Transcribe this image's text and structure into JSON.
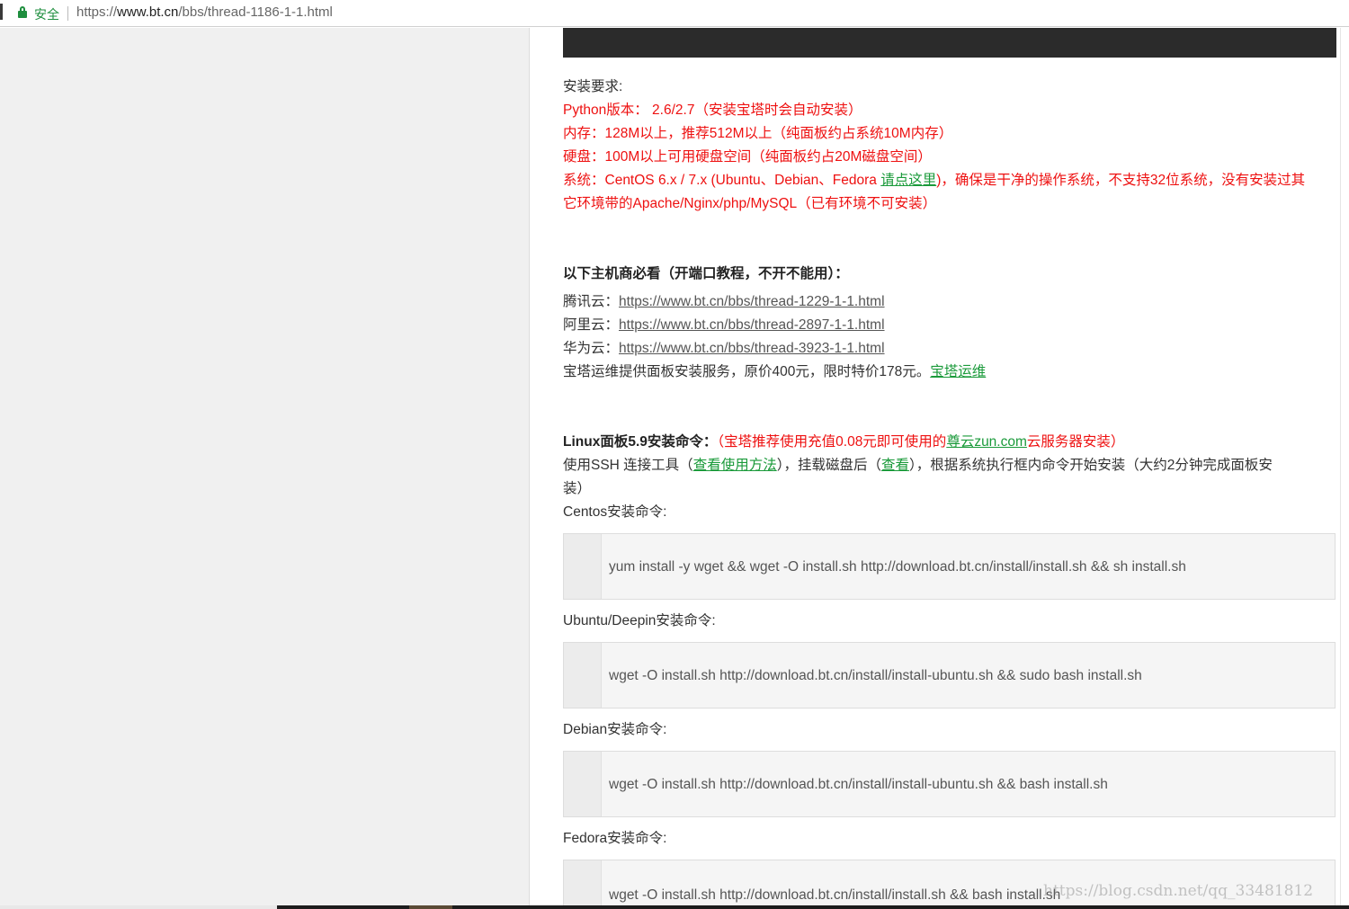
{
  "browser": {
    "secure_label": "安全",
    "url_scheme": "https://",
    "url_host": "www.bt.cn",
    "url_path": "/bbs/thread-1186-1-1.html"
  },
  "requirements": {
    "heading": "安装要求:",
    "python": "Python版本： 2.6/2.7（安装宝塔时会自动安装）",
    "memory": "内存：128M以上，推荐512M以上（纯面板约占系统10M内存）",
    "disk": "硬盘：100M以上可用硬盘空间（纯面板约占20M磁盘空间）",
    "system_prefix": "系统：CentOS 6.x / 7.x (Ubuntu、Debian、Fedora ",
    "system_link": "请点这里",
    "system_suffix": ")，确保是干净的操作系统，不支持32位系统，没有安装过其",
    "system_line2": "它环境带的Apache/Nginx/php/MySQL（已有环境不可安装）"
  },
  "hosts": {
    "heading": "以下主机商必看（开端口教程，不开不能用）：",
    "items": [
      {
        "label": "腾讯云：",
        "url": "https://www.bt.cn/bbs/thread-1229-1-1.html"
      },
      {
        "label": "阿里云：",
        "url": "https://www.bt.cn/bbs/thread-2897-1-1.html"
      },
      {
        "label": "华为云：",
        "url": "https://www.bt.cn/bbs/thread-3923-1-1.html"
      }
    ],
    "service_text": "宝塔运维提供面板安装服务，原价400元，限时特价178元。",
    "service_link": "宝塔运维"
  },
  "install": {
    "heading": "Linux面板5.9安装命令：",
    "promo_prefix": "（宝塔推荐使用充值0.08元即可使用的",
    "promo_link": "尊云zun.com",
    "promo_suffix": "云服务器安装）",
    "ssh_a": "使用SSH 连接工具（",
    "ssh_link1": "查看使用方法",
    "ssh_b": "），挂载磁盘后（",
    "ssh_link2": "查看",
    "ssh_c": "），根据系统执行框内命令开始安装（大约2分钟完成面板安",
    "ssh_line2": "装）",
    "centos_label": "Centos安装命令:",
    "centos_cmd": "yum install -y wget && wget -O install.sh http://download.bt.cn/install/install.sh && sh install.sh",
    "ubuntu_label": "Ubuntu/Deepin安装命令:",
    "ubuntu_cmd": "wget -O install.sh http://download.bt.cn/install/install-ubuntu.sh && sudo bash install.sh",
    "debian_label": "Debian安装命令:",
    "debian_cmd": "wget -O install.sh http://download.bt.cn/install/install-ubuntu.sh && bash install.sh",
    "fedora_label": "Fedora安装命令:",
    "fedora_cmd": "wget -O install.sh http://download.bt.cn/install/install.sh && bash install.sh"
  },
  "watermark": "https://blog.csdn.net/qq_33481812"
}
